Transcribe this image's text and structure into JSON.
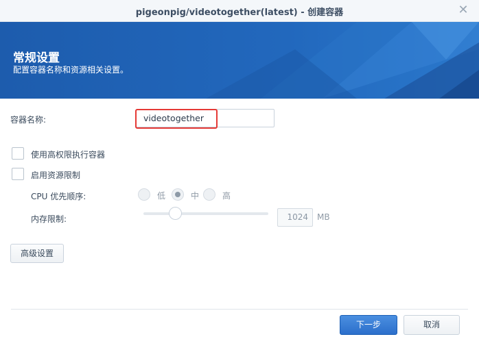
{
  "window": {
    "title": "pigeonpig/videotogether(latest) - 创建容器",
    "close_icon": "close-icon"
  },
  "banner": {
    "heading": "常规设置",
    "subheading": "配置容器名称和资源相关设置。",
    "colors": {
      "base": "#1e5fb0",
      "light": "#3a86d8"
    }
  },
  "form": {
    "container_name_label": "容器名称:",
    "container_name_value": "videotogether",
    "privileged_label": "使用高权限执行容器",
    "privileged_checked": false,
    "resource_limit_label": "启用资源限制",
    "resource_limit_checked": false,
    "cpu_priority_label": "CPU 优先顺序:",
    "cpu_options": [
      "低",
      "中",
      "高"
    ],
    "cpu_selected": "中",
    "memory_label": "内存限制:",
    "memory_value": "1024",
    "memory_unit": "MB",
    "highlight_color": "#e53935"
  },
  "buttons": {
    "advanced": "高级设置",
    "next": "下一步",
    "cancel": "取消"
  }
}
